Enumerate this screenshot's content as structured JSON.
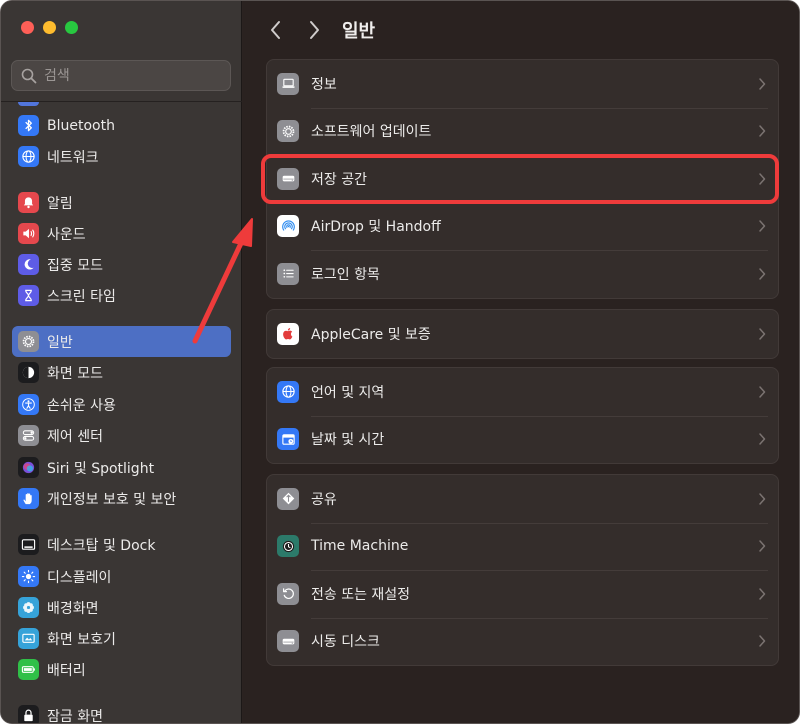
{
  "window": {
    "title": "일반",
    "search_placeholder": "검색"
  },
  "sidebar": {
    "items": [
      {
        "label": "Bluetooth",
        "icon": "bluetooth-icon",
        "color": "#3478f6"
      },
      {
        "label": "네트워크",
        "icon": "globe-icon",
        "color": "#3478f6"
      },
      {
        "label": "알림",
        "icon": "bell-icon",
        "color": "#e5484d"
      },
      {
        "label": "사운드",
        "icon": "speaker-icon",
        "color": "#e5484d"
      },
      {
        "label": "집중 모드",
        "icon": "moon-icon",
        "color": "#5e5ce6"
      },
      {
        "label": "스크린 타임",
        "icon": "hourglass-icon",
        "color": "#5e5ce6"
      },
      {
        "label": "일반",
        "icon": "gear-icon",
        "color": "#8e8e93"
      },
      {
        "label": "화면 모드",
        "icon": "appearance-icon",
        "color": "#1c1c1e"
      },
      {
        "label": "손쉬운 사용",
        "icon": "accessibility-icon",
        "color": "#3478f6"
      },
      {
        "label": "제어 센터",
        "icon": "toggles-icon",
        "color": "#8e8e93"
      },
      {
        "label": "Siri 및 Spotlight",
        "icon": "siri-icon",
        "color": "#1c1c1e"
      },
      {
        "label": "개인정보 보호 및 보안",
        "icon": "hand-icon",
        "color": "#3478f6"
      },
      {
        "label": "데스크탑 및 Dock",
        "icon": "dock-icon",
        "color": "#1c1c1e"
      },
      {
        "label": "디스플레이",
        "icon": "sun-icon",
        "color": "#3478f6"
      },
      {
        "label": "배경화면",
        "icon": "flower-icon",
        "color": "#36a3d9"
      },
      {
        "label": "화면 보호기",
        "icon": "screensaver-icon",
        "color": "#36a3d9"
      },
      {
        "label": "배터리",
        "icon": "battery-icon",
        "color": "#30c048"
      },
      {
        "label": "잠금 화면",
        "icon": "lock-icon",
        "color": "#1c1c1e"
      }
    ],
    "selected": "일반"
  },
  "main": {
    "groups": [
      {
        "rows": [
          {
            "label": "정보",
            "icon": "laptop-icon",
            "color": "#8e8e93"
          },
          {
            "label": "소프트웨어 업데이트",
            "icon": "gear-badge-icon",
            "color": "#8e8e93"
          },
          {
            "label": "저장 공간",
            "icon": "drive-icon",
            "color": "#8e8e93"
          },
          {
            "label": "AirDrop 및 Handoff",
            "icon": "airdrop-icon",
            "color": "#ffffff"
          },
          {
            "label": "로그인 항목",
            "icon": "list-icon",
            "color": "#8e8e93"
          }
        ]
      },
      {
        "rows": [
          {
            "label": "AppleCare 및 보증",
            "icon": "apple-icon",
            "color": "#ffffff"
          }
        ]
      },
      {
        "rows": [
          {
            "label": "언어 및 지역",
            "icon": "globe-icon",
            "color": "#3478f6"
          },
          {
            "label": "날짜 및 시간",
            "icon": "calendar-clock-icon",
            "color": "#3478f6"
          }
        ]
      },
      {
        "rows": [
          {
            "label": "공유",
            "icon": "share-icon",
            "color": "#8e8e93"
          },
          {
            "label": "Time Machine",
            "icon": "time-machine-icon",
            "color": "#2c7a6a"
          },
          {
            "label": "전송 또는 재설정",
            "icon": "reset-icon",
            "color": "#8e8e93"
          },
          {
            "label": "시동 디스크",
            "icon": "disk-icon",
            "color": "#8e8e93"
          }
        ]
      }
    ]
  },
  "annotation": {
    "highlight_color": "#ee3b3b"
  }
}
